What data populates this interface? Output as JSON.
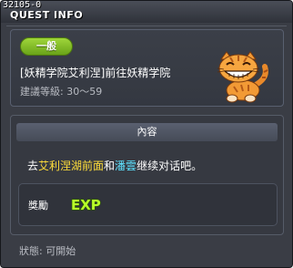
{
  "window": {
    "quest_id": "32105-0",
    "title": "QUEST INFO"
  },
  "quest": {
    "category": "一般",
    "name": "[妖精学院艾利涅]前往妖精学院",
    "level_label": "建議等級:",
    "level_range": "30～59"
  },
  "content": {
    "header": "內容",
    "text_prefix": "去",
    "highlight_location": "艾利涅湖前面",
    "text_middle": "和",
    "highlight_npc": "潘雲",
    "text_suffix": "继续对话吧。"
  },
  "reward": {
    "label": "獎勵",
    "exp_icon_text": "EXP"
  },
  "status": {
    "label": "狀態: ",
    "value": "可開始"
  },
  "colors": {
    "window_bg": "#3a3d45",
    "badge_green": "#7fbf24",
    "highlight_yellow": "#ffde3a",
    "highlight_cyan": "#5fe2ff",
    "exp_green": "#b8ff2a"
  },
  "icons": {
    "mascot": "orange-tabby-cat-icon",
    "reward": "exp-icon"
  }
}
